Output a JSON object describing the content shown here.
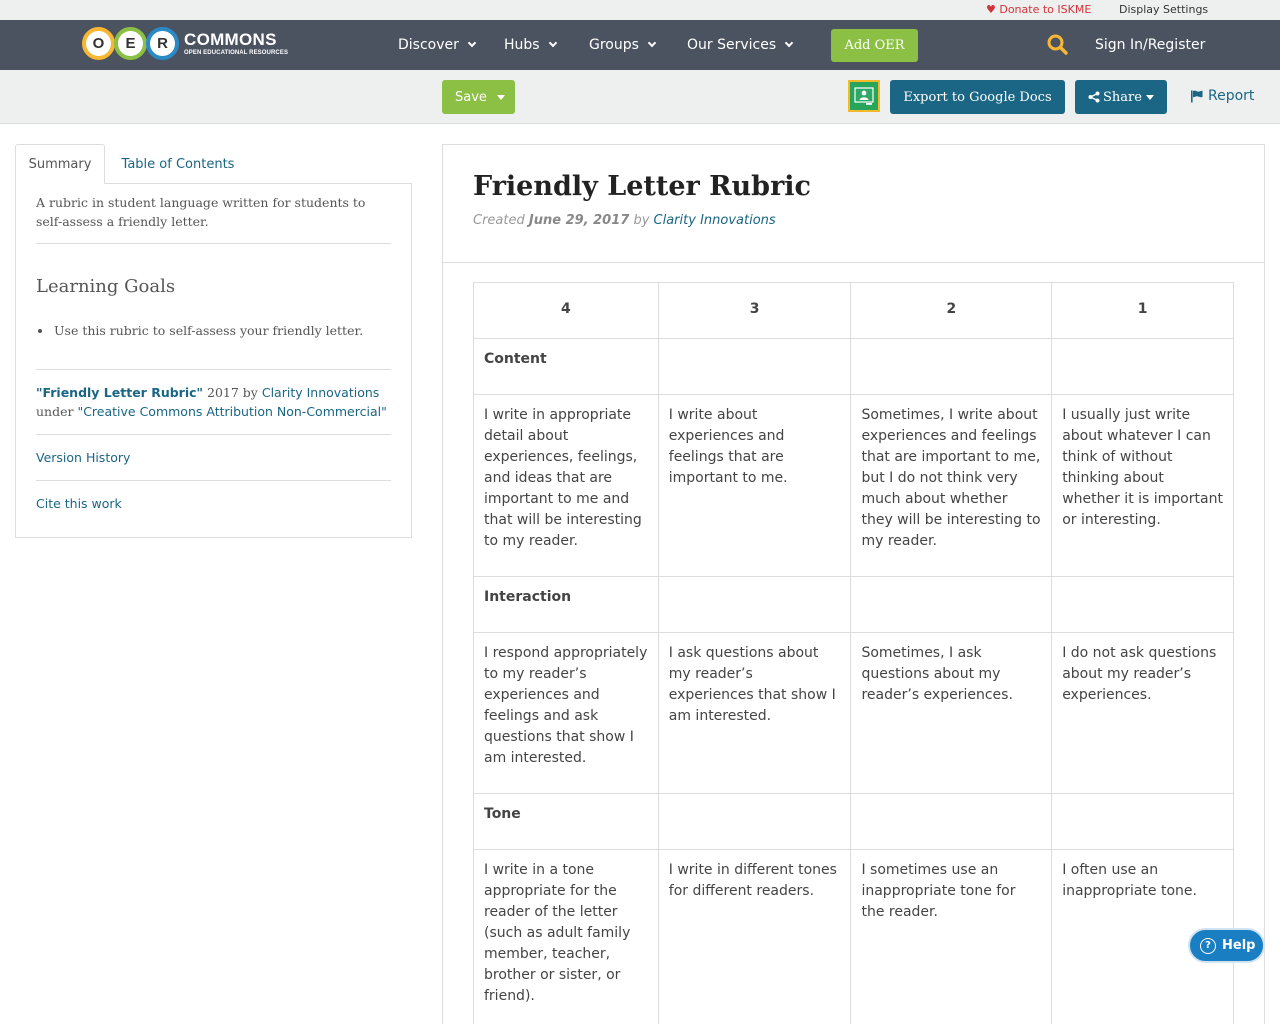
{
  "utility": {
    "donate": "Donate to ISKME",
    "display_settings": "Display Settings"
  },
  "logo": {
    "letters": [
      "O",
      "E",
      "R"
    ],
    "name": "COMMONS",
    "tagline": "OPEN EDUCATIONAL RESOURCES"
  },
  "nav": {
    "items": [
      "Discover",
      "Hubs",
      "Groups",
      "Our Services"
    ],
    "add_oer": "Add OER",
    "signin": "Sign In/Register"
  },
  "toolbar": {
    "save": "Save",
    "export": "Export to Google Docs",
    "share": "Share",
    "report": "Report"
  },
  "sidebar": {
    "tabs": [
      "Summary",
      "Table of Contents"
    ],
    "description": "A rubric in student language written for students to self-assess a friendly letter.",
    "learning_goals_title": "Learning Goals",
    "learning_goals": [
      "Use this rubric to self-assess your friendly letter."
    ],
    "attribution": {
      "title": "\"Friendly Letter Rubric\"",
      "year": " 2017 by ",
      "author": "Clarity Innovations",
      "under": "under ",
      "license": "\"Creative Commons Attribution Non-Commercial\""
    },
    "version_history": "Version History",
    "cite": "Cite this work"
  },
  "resource": {
    "title": "Friendly Letter Rubric",
    "created_label": "Created ",
    "date": "June 29, 2017",
    "by_label": " by ",
    "author": "Clarity Innovations"
  },
  "rubric": {
    "headers": [
      "4",
      "3",
      "2",
      "1"
    ],
    "rows": [
      {
        "category": "Content",
        "cells": [
          "I write in appropriate detail about experiences, feelings, and ideas that are important to me and that will be interesting to my reader.",
          "I write about experiences and feelings that are important to me.",
          "Sometimes, I write about experiences and feelings that are important to me, but I do not think very much about whether they will be interesting to my reader.",
          "I usually just write about whatever I can think of without thinking about whether it is important or interesting."
        ]
      },
      {
        "category": "Interaction",
        "cells": [
          "I respond appropriately to my reader’s experiences and feelings and ask questions that show I am interested.",
          "I ask questions about my reader’s experiences that show I am interested.",
          "Sometimes, I ask questions about my reader’s experiences.",
          "I do not ask questions about my reader’s experiences."
        ]
      },
      {
        "category": "Tone",
        "cells": [
          "I write in a tone appropriate for the reader of the letter (such as adult family member, teacher, brother or sister, or friend).",
          "I write in different tones for different readers.",
          "I sometimes use an inappropriate tone for the reader.",
          "I often use an inappropriate tone."
        ]
      }
    ]
  },
  "help": "Help",
  "colors": {
    "nav_bg": "#4b5360",
    "green": "#8cc045",
    "teal": "#1a6684",
    "red": "#d0343a"
  }
}
